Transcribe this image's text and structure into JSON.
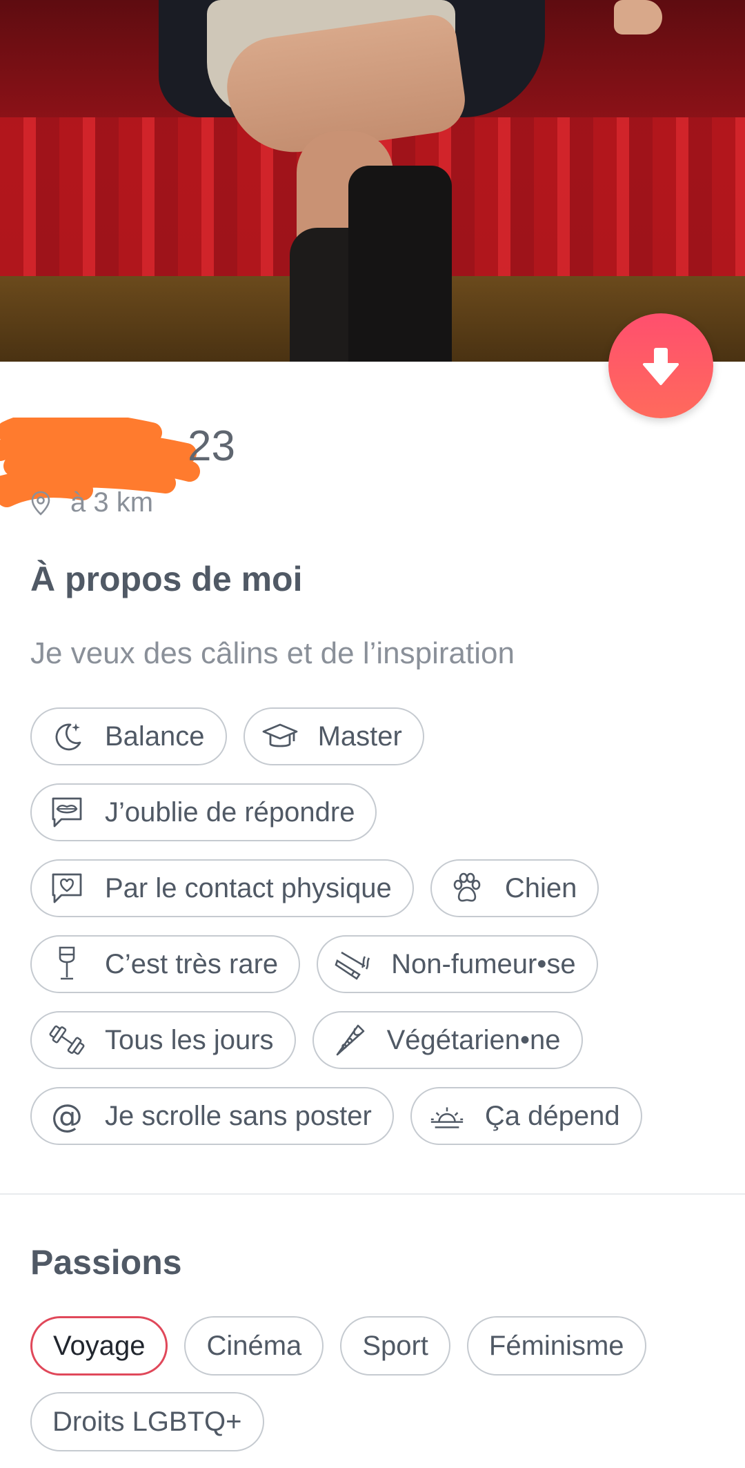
{
  "profile": {
    "age": "23",
    "distance": "à 3 km"
  },
  "about": {
    "title": "À propos de moi",
    "text": "Je veux des câlins et de l’inspiration"
  },
  "chips": {
    "zodiac": {
      "label": "Balance",
      "icon": "moon-stars-icon"
    },
    "education": {
      "label": "Master",
      "icon": "graduation-cap-icon"
    },
    "communication": {
      "label": "J’oublie de répondre",
      "icon": "lips-message-icon"
    },
    "love_language": {
      "label": "Par le contact physique",
      "icon": "heart-message-icon"
    },
    "pets": {
      "label": "Chien",
      "icon": "paw-icon"
    },
    "drinking": {
      "label": "C’est très rare",
      "icon": "wine-glass-icon"
    },
    "smoking": {
      "label": "Non-fumeur•se",
      "icon": "cigarette-icon"
    },
    "workout": {
      "label": "Tous les jours",
      "icon": "dumbbell-icon"
    },
    "diet": {
      "label": "Végétarien•ne",
      "icon": "pizza-icon"
    },
    "social_media": {
      "label": "Je scrolle sans poster",
      "icon": "at-sign-icon"
    },
    "sleep": {
      "label": "Ça dépend",
      "icon": "sunrise-icon"
    }
  },
  "passions": {
    "title": "Passions",
    "items": [
      "Voyage",
      "Cinéma",
      "Sport",
      "Féminisme",
      "Droits LGBTQ+"
    ],
    "active_index": 0
  },
  "colors": {
    "accent": "#ff5864",
    "active_chip_border": "#e0485a",
    "chip_border": "#c5cad0"
  }
}
